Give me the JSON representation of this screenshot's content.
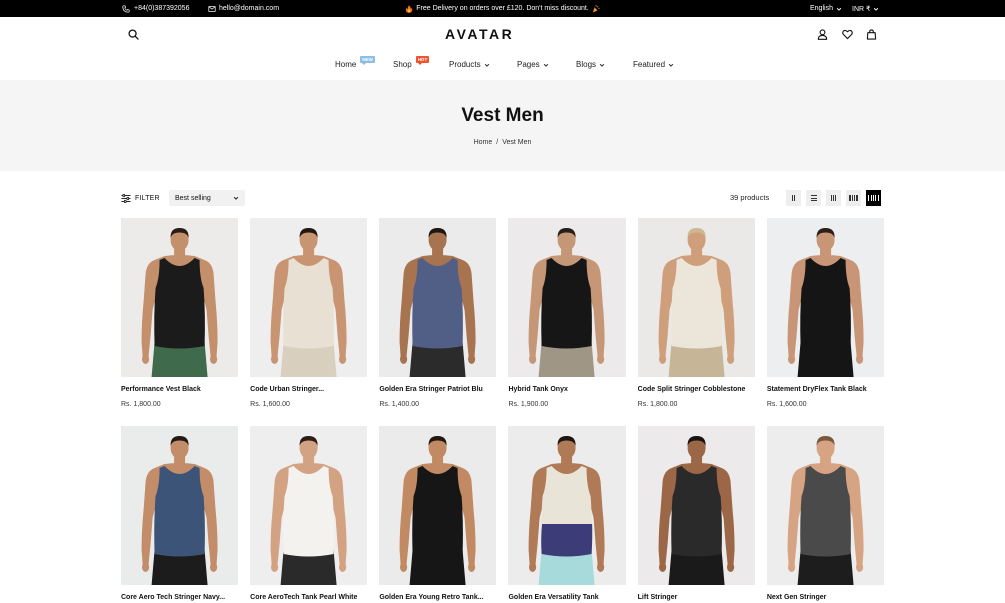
{
  "topbar": {
    "phone": "+84(0)387392056",
    "email": "hello@domain.com",
    "announcement": "Free Delivery on orders over £120. Don't miss discount.",
    "announcement_icons": {
      "left": "fire-icon",
      "right": "celebrate-icon"
    },
    "language": "English",
    "currency": "INR ₹"
  },
  "header": {
    "logo": "AVATAR",
    "icons": [
      "search-icon",
      "user-icon",
      "heart-icon",
      "bag-icon"
    ],
    "nav": [
      {
        "label": "Home",
        "badge": "NEW",
        "badge_color": "#8ebde6"
      },
      {
        "label": "Shop",
        "badge": "HOT",
        "badge_color": "#f0532f"
      },
      {
        "label": "Products",
        "dropdown": true
      },
      {
        "label": "Pages",
        "dropdown": true
      },
      {
        "label": "Blogs",
        "dropdown": true
      },
      {
        "label": "Featured",
        "dropdown": true
      }
    ]
  },
  "banner": {
    "title": "Vest Men",
    "breadcrumb": [
      "Home",
      "Vest Men"
    ],
    "breadcrumb_separator": "/"
  },
  "toolbar": {
    "filter_label": "FILTER",
    "sort_value": "Best selling",
    "product_count": "39 products",
    "view_icons": [
      "grid-2-icon",
      "list-icon",
      "grid-3-icon",
      "grid-4-icon",
      "grid-6-icon"
    ],
    "active_view": "grid-6-icon"
  },
  "colors": {
    "topbar_bg": "#000000",
    "banner_bg": "#f5f5f5",
    "active_view_bg": "#000000"
  },
  "products": [
    {
      "title": "Performance Vest Black",
      "price": "Rs. 1,800.00",
      "photo": {
        "bg": "#ecebea",
        "skin": "#c48f6b",
        "hair": "#2a1d16",
        "tank": "#1b1b1b",
        "shorts": "#3f6b4c"
      }
    },
    {
      "title": "Code Urban Stringer...",
      "price": "Rs. 1,600.00",
      "photo": {
        "bg": "#eeeeee",
        "skin": "#c99472",
        "hair": "#231812",
        "tank": "#e8e0d2",
        "shorts": "#d8cfbf"
      }
    },
    {
      "title": "Golden Era Stringer Patriot Blu",
      "price": "Rs. 1,400.00",
      "photo": {
        "bg": "#ebebeb",
        "skin": "#a8734f",
        "hair": "#1e1611",
        "tank": "#515f86",
        "shorts": "#2b2b2b"
      }
    },
    {
      "title": "Hybrid Tank Onyx",
      "price": "Rs. 1,900.00",
      "photo": {
        "bg": "#eceaea",
        "skin": "#c69776",
        "hair": "#2a1f18",
        "tank": "#161616",
        "shorts": "#a09686"
      }
    },
    {
      "title": "Code Split Stringer Cobblestone",
      "price": "Rs. 1,800.00",
      "photo": {
        "bg": "#ebe9e7",
        "skin": "#cf9f7c",
        "hair": "#cdb98e",
        "tank": "#ece6da",
        "shorts": "#c6b596"
      }
    },
    {
      "title": "Statement DryFlex Tank Black",
      "price": "Rs. 1,600.00",
      "photo": {
        "bg": "#eceeef",
        "skin": "#c89676",
        "hair": "#2b2019",
        "tank": "#151515",
        "shorts": "#151515"
      }
    },
    {
      "title": "Core Aero Tech Stringer Navy...",
      "photo": {
        "bg": "#eaecec",
        "skin": "#c48d69",
        "hair": "#241a14",
        "tank": "#3c5478",
        "shorts": "#1c1c1c"
      }
    },
    {
      "title": "Core AeroTech Tank Pearl White",
      "photo": {
        "bg": "#eeeeee",
        "skin": "#d3a282",
        "hair": "#2b1e17",
        "tank": "#f4f2ee",
        "shorts": "#2a2a2a"
      }
    },
    {
      "title": "Golden Era Young Retro Tank...",
      "photo": {
        "bg": "#ebebeb",
        "skin": "#c18a63",
        "hair": "#211812",
        "tank": "#161616",
        "shorts": "#161616"
      }
    },
    {
      "title": "Golden Era Versatility Tank",
      "photo": {
        "bg": "#ececec",
        "skin": "#b07a56",
        "hair": "#1d1511",
        "tank": "#e9e4d8",
        "tank_bottom": "#3b3c78",
        "shorts": "#a7dadb"
      }
    },
    {
      "title": "Lift Stringer",
      "photo": {
        "bg": "#eceaea",
        "skin": "#9c6746",
        "hair": "#1a130f",
        "tank": "#2a2a2a",
        "shorts": "#1a1a1a"
      }
    },
    {
      "title": "Next Gen Stringer",
      "photo": {
        "bg": "#ededed",
        "skin": "#d6a482",
        "hair": "#7a5a3c",
        "tank": "#4a4a4a",
        "shorts": "#1d1d1d"
      }
    }
  ]
}
